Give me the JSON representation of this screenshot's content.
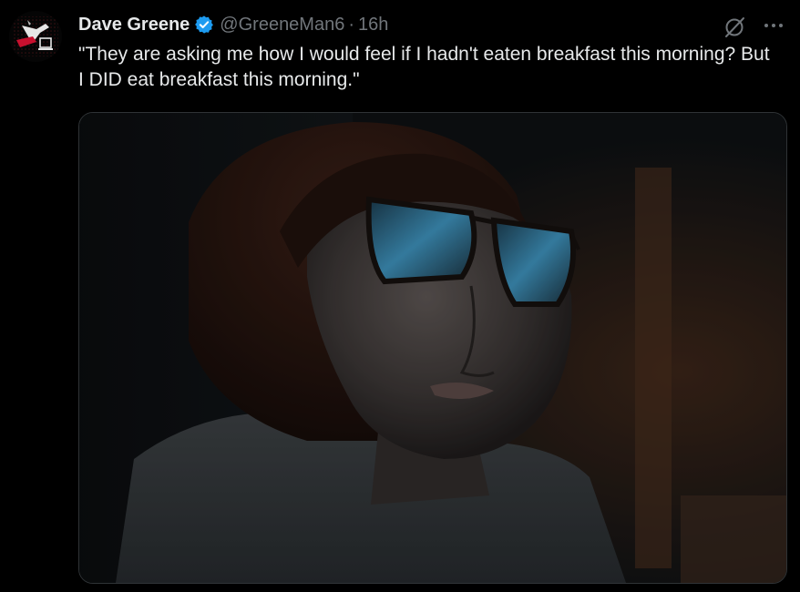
{
  "tweet": {
    "author": {
      "display_name": "Dave Greene",
      "handle": "@GreeneMan6",
      "verified": true,
      "avatar_icon": "avatar-logo-icon"
    },
    "separator": "·",
    "timestamp": "16h",
    "text": "\"They are asking me how I would feel if I hadn't eaten breakfast this morning? But I DID eat breakfast this morning.\"",
    "actions": {
      "grok_icon": "grok-slash-circle-icon",
      "more_icon": "more-horizontal-icon"
    },
    "media": {
      "type": "image",
      "subject_icon": "woman-in-glasses-photo"
    }
  },
  "colors": {
    "background": "#000000",
    "text_primary": "#e7e9ea",
    "text_secondary": "#71767b",
    "verified_blue": "#1d9bf0",
    "border": "#2f3336"
  }
}
